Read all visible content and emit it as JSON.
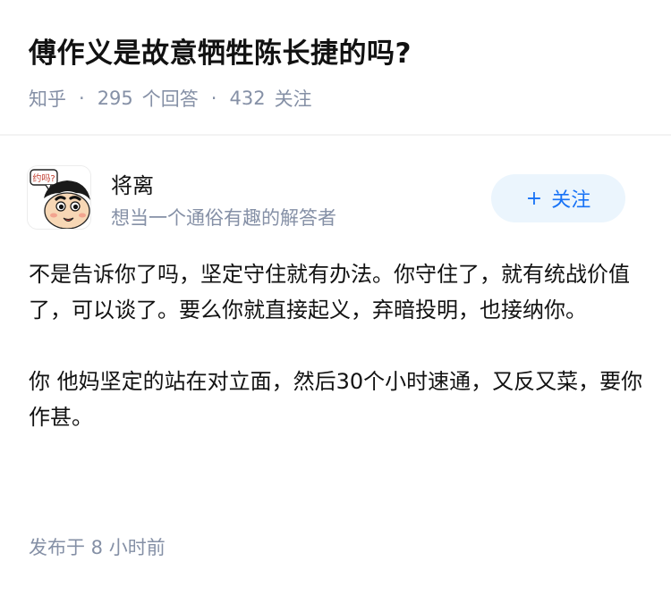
{
  "question": {
    "title": "傅作义是故意牺牲陈长捷的吗?",
    "platform": "知乎",
    "answer_count": "295",
    "answer_label": "个回答",
    "follower_count": "432",
    "follower_label": "关注"
  },
  "answer": {
    "author": {
      "name": "将离",
      "bio": "想当一个通俗有趣的解答者",
      "avatar_icon": "cartoon-boy-avatar-icon",
      "avatar_caption": "约吗?"
    },
    "follow_button": {
      "icon": "plus-icon",
      "plus": "+",
      "label": "关注"
    },
    "paragraphs": [
      "不是告诉你了吗，坚定守住就有办法。你守住了，就有统战价值了，可以谈了。要么你就直接起义，弃暗投明，也接纳你。",
      "你 他妈坚定的站在对立面，然后30个小时速通，又反又菜，要你作甚。"
    ],
    "posted_time": "发布于 8 小时前"
  },
  "colors": {
    "title": "#121212",
    "meta_gray": "#8590a6",
    "accent_blue": "#1772f6",
    "button_bg": "#ebf5fd"
  }
}
